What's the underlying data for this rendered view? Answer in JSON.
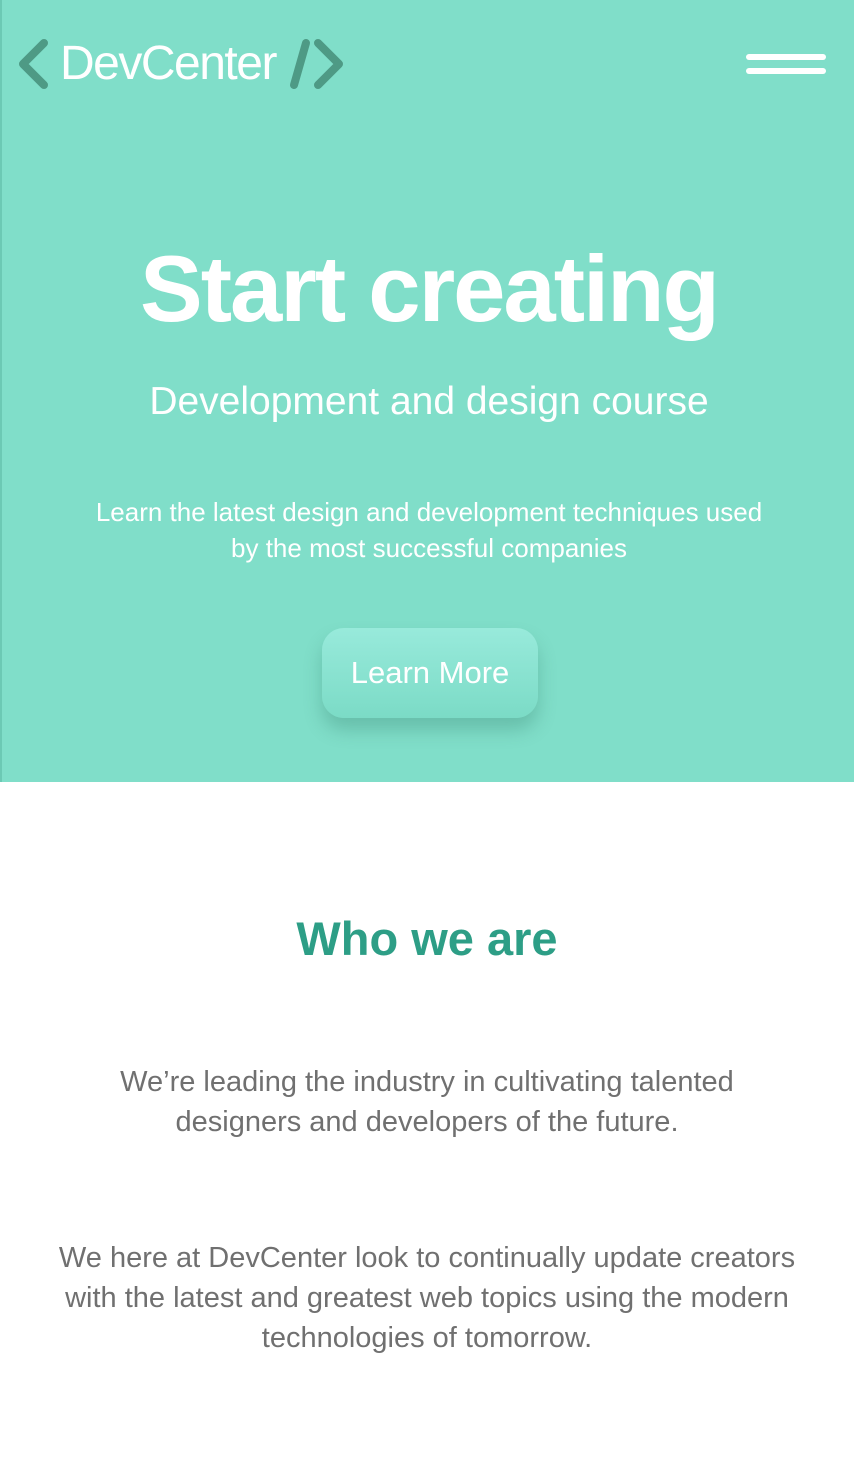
{
  "header": {
    "logo_text": "DevCenter",
    "logo_icon_left": "chevron-left-icon",
    "logo_icon_right": "code-close-icon",
    "menu_icon": "hamburger-icon"
  },
  "hero": {
    "title": "Start creating",
    "subtitle": "Development and design course",
    "description": "Learn the latest design and development techniques used by the most successful companies",
    "cta_label": "Learn More"
  },
  "about": {
    "heading": "Who we are",
    "paragraph_1": "We’re leading the industry in cultivating talented designers and developers of the future.",
    "paragraph_2": "We here at DevCenter look to continually update creators with the latest and greatest web topics using the modern technologies of tomorrow."
  },
  "colors": {
    "hero_background": "#80dec9",
    "accent": "#2d9e86",
    "logo_symbols": "#4e9a85",
    "body_text": "#707070"
  }
}
